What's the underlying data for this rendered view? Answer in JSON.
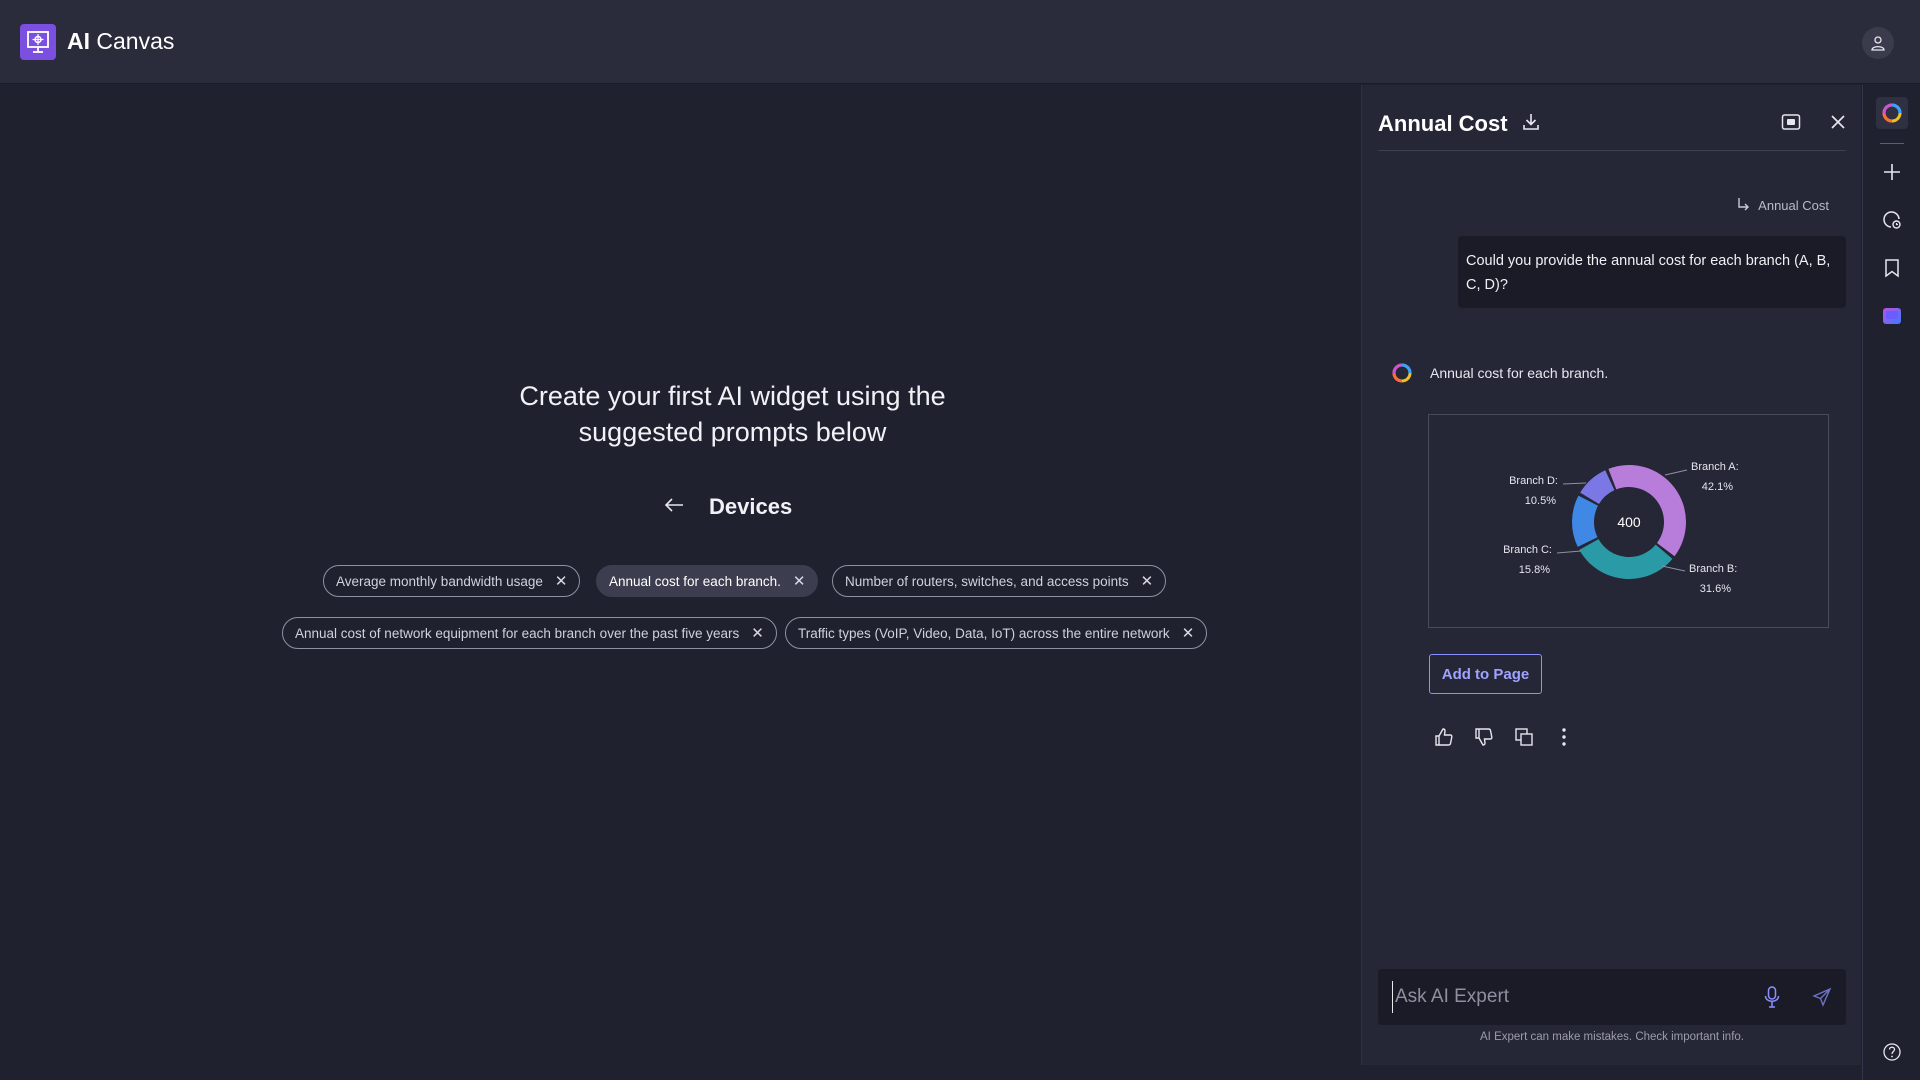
{
  "app": {
    "title_bold": "AI",
    "title_rest": " Canvas"
  },
  "main": {
    "hero_line1": "Create your first AI widget using the",
    "hero_line2": "suggested prompts below",
    "section_title": "Devices",
    "chips": [
      {
        "label": "Average monthly bandwidth usage",
        "selected": false
      },
      {
        "label": "Annual cost for each branch.",
        "selected": true
      },
      {
        "label": "Number of routers, switches, and access points",
        "selected": false
      },
      {
        "label": "Annual cost of network equipment for each branch over the past five years",
        "selected": false
      },
      {
        "label": "Traffic types (VoIP, Video, Data, IoT) across the entire network",
        "selected": false
      }
    ]
  },
  "panel": {
    "title": "Annual Cost",
    "reference": "Annual Cost",
    "user_message": "Could you provide the annual cost for each branch (A, B, C, D)?",
    "ai_message": "Annual cost for each branch.",
    "add_button": "Add to Page",
    "input_placeholder": "Ask AI Expert",
    "disclaimer": "AI Expert can make mistakes. Check important info."
  },
  "chart_data": {
    "type": "pie",
    "center_label": "400",
    "slices": [
      {
        "name": "Branch A:",
        "percent_label": "42.1%",
        "value": 42.1,
        "color": "#b87ddb"
      },
      {
        "name": "Branch B:",
        "percent_label": "31.6%",
        "value": 31.6,
        "color": "#2a9aa6"
      },
      {
        "name": "Branch C:",
        "percent_label": "15.8%",
        "value": 15.8,
        "color": "#3f88e6"
      },
      {
        "name": "Branch D:",
        "percent_label": "10.5%",
        "value": 10.5,
        "color": "#7b78e6"
      }
    ]
  },
  "colors": {
    "accent": "#7b4fe0",
    "button": "#8b8fff"
  }
}
